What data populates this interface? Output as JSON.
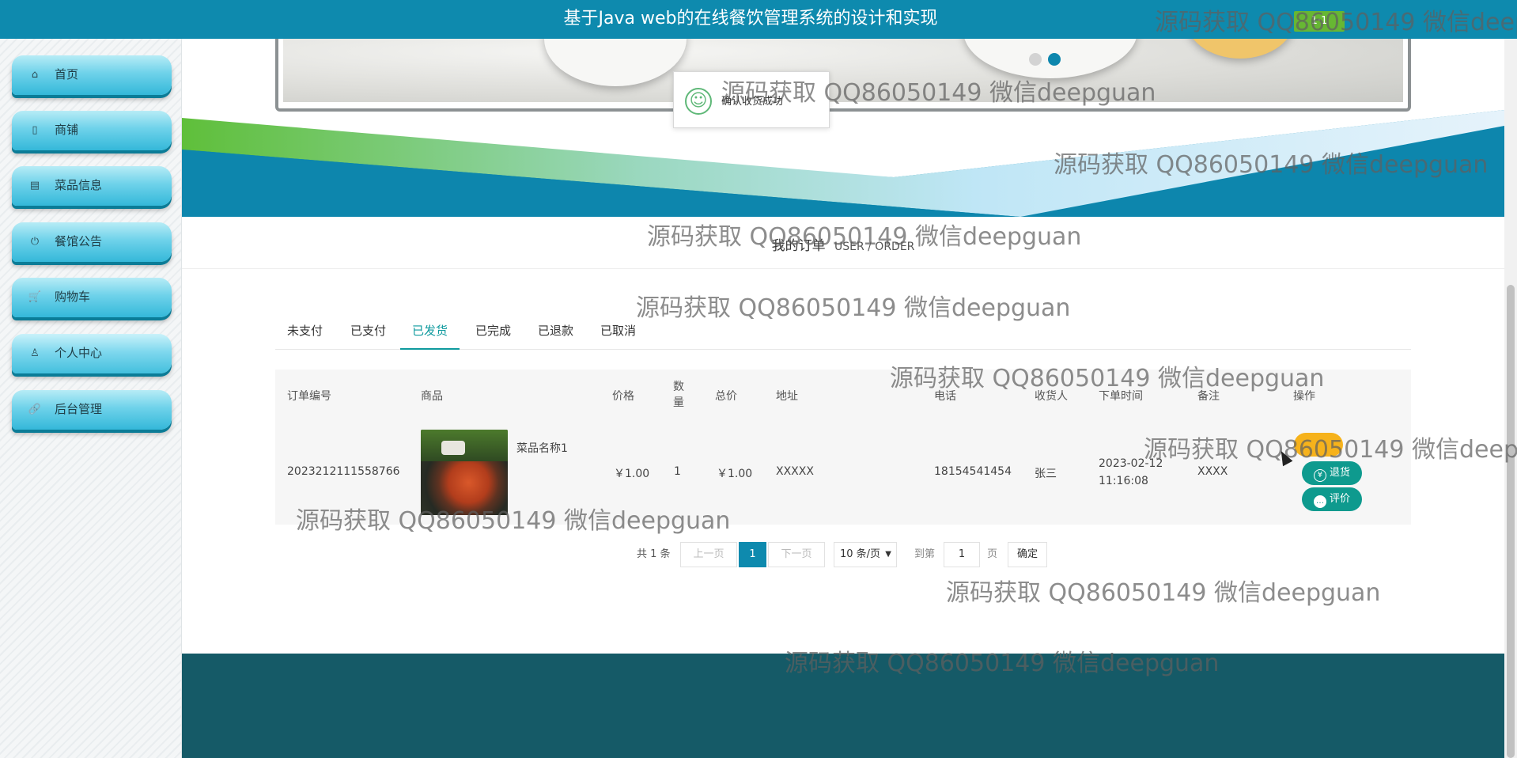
{
  "header": {
    "title": "基于Java web的在线餐饮管理系统的设计和实现",
    "user_button": "1·1"
  },
  "sidebar": {
    "items": [
      {
        "label": "首页",
        "icon": "home-icon"
      },
      {
        "label": "商铺",
        "icon": "shop-icon"
      },
      {
        "label": "菜品信息",
        "icon": "clipboard-icon"
      },
      {
        "label": "餐馆公告",
        "icon": "power-icon"
      },
      {
        "label": "购物车",
        "icon": "cart-icon"
      },
      {
        "label": "个人中心",
        "icon": "user-icon"
      },
      {
        "label": "后台管理",
        "icon": "link-icon"
      }
    ]
  },
  "toast": {
    "message": "确认收货成功"
  },
  "order_section": {
    "title": "我的订单",
    "subtitle": "USER / ORDER"
  },
  "tabs": [
    "未支付",
    "已支付",
    "已发货",
    "已完成",
    "已退款",
    "已取消"
  ],
  "table": {
    "headers": {
      "order_no": "订单编号",
      "goods": "商品",
      "price": "价格",
      "qty_line1": "数",
      "qty_line2": "量",
      "total": "总价",
      "address": "地址",
      "phone": "电话",
      "receiver": "收货人",
      "order_time": "下单时间",
      "remark": "备注",
      "action": "操作"
    },
    "row": {
      "order_no": "2023212111558766",
      "goods_name": "菜品名称1",
      "price": "￥1.00",
      "qty": "1",
      "total": "￥1.00",
      "address": "XXXXX",
      "phone": "18154541454",
      "receiver": "张三",
      "order_date": "2023-02-12",
      "order_clock": "11:16:08",
      "remark": "XXXX"
    },
    "actions": {
      "refund": "退货",
      "review": "评价"
    }
  },
  "pagination": {
    "total_text": "共 1 条",
    "prev": "上一页",
    "current": "1",
    "next": "下一页",
    "page_size": "10 条/页",
    "goto_label": "到第",
    "goto_value": "1",
    "page_unit": "页",
    "confirm": "确定"
  },
  "watermark": "源码获取 QQ86050149 微信deepguan",
  "colors": {
    "primary": "#0e8aae",
    "accent_green": "#0e9a9e",
    "footer": "#155a67"
  }
}
